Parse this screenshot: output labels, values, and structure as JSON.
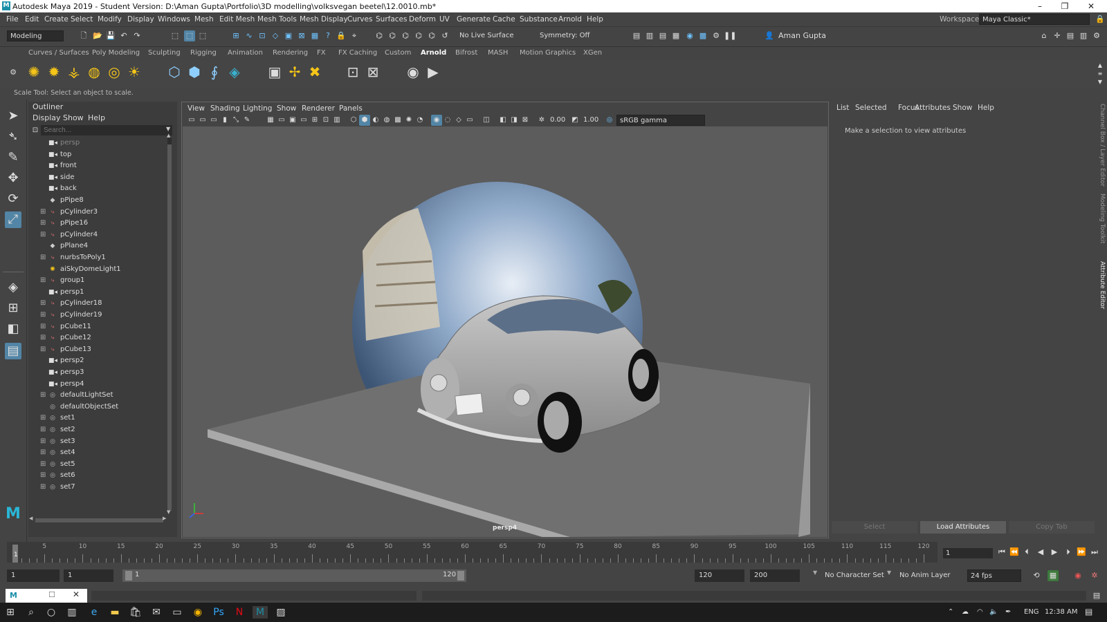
{
  "titlebar": {
    "logo": "M",
    "title": "Autodesk Maya 2019 - Student Version: D:\\Aman Gupta\\Portfolio\\3D modelling\\volksvegan beetel\\12.0010.mb*",
    "minimize": "–",
    "restore": "❐",
    "close": "✕"
  },
  "menubar": {
    "items": [
      "File",
      "Edit",
      "Create",
      "Select",
      "Modify",
      "Display",
      "Windows",
      "Mesh",
      "Edit Mesh",
      "Mesh Tools",
      "Mesh Display",
      "Curves",
      "Surfaces",
      "Deform",
      "UV",
      "Generate",
      "Cache",
      "Substance",
      "Arnold",
      "Help"
    ],
    "workspace_label": "Workspace :",
    "workspace_value": "Maya Classic*"
  },
  "statusline": {
    "mode": "Modeling",
    "live_surface": "No Live Surface",
    "symmetry": "Symmetry: Off",
    "user": "Aman Gupta"
  },
  "shelf": {
    "tabs": [
      "Curves / Surfaces",
      "Poly Modeling",
      "Sculpting",
      "Rigging",
      "Animation",
      "Rendering",
      "FX",
      "FX Caching",
      "Custom",
      "Arnold",
      "Bifrost",
      "MASH",
      "Motion Graphics",
      "XGen"
    ],
    "active_tab": "Arnold"
  },
  "helpline": {
    "text": "Scale Tool: Select an object to scale."
  },
  "outliner": {
    "title": "Outliner",
    "menu": [
      "Display",
      "Show",
      "Help"
    ],
    "search_placeholder": "Search...",
    "items": [
      {
        "label": "persp",
        "icon": "camera-icon",
        "expand": false,
        "dim": true
      },
      {
        "label": "top",
        "icon": "camera-icon",
        "expand": false
      },
      {
        "label": "front",
        "icon": "camera-icon",
        "expand": false
      },
      {
        "label": "side",
        "icon": "camera-icon",
        "expand": false
      },
      {
        "label": "back",
        "icon": "camera-icon",
        "expand": false
      },
      {
        "label": "pPipe8",
        "icon": "mesh-icon",
        "expand": false
      },
      {
        "label": "pCylinder3",
        "icon": "transform-icon",
        "expand": true
      },
      {
        "label": "pPipe16",
        "icon": "transform-icon",
        "expand": true
      },
      {
        "label": "pCylinder4",
        "icon": "transform-icon",
        "expand": true
      },
      {
        "label": "pPlane4",
        "icon": "mesh-icon",
        "expand": false
      },
      {
        "label": "nurbsToPoly1",
        "icon": "transform-icon",
        "expand": true
      },
      {
        "label": "aiSkyDomeLight1",
        "icon": "light-icon",
        "expand": false
      },
      {
        "label": "group1",
        "icon": "transform-icon",
        "expand": true
      },
      {
        "label": "persp1",
        "icon": "camera-icon",
        "expand": false
      },
      {
        "label": "pCylinder18",
        "icon": "transform-icon",
        "expand": true
      },
      {
        "label": "pCylinder19",
        "icon": "transform-icon",
        "expand": true
      },
      {
        "label": "pCube11",
        "icon": "transform-icon",
        "expand": true
      },
      {
        "label": "pCube12",
        "icon": "transform-icon",
        "expand": true
      },
      {
        "label": "pCube13",
        "icon": "transform-icon",
        "expand": true
      },
      {
        "label": "persp2",
        "icon": "camera-icon",
        "expand": false
      },
      {
        "label": "persp3",
        "icon": "camera-icon",
        "expand": false
      },
      {
        "label": "persp4",
        "icon": "camera-icon",
        "expand": false
      },
      {
        "label": "defaultLightSet",
        "icon": "set-icon",
        "expand": true
      },
      {
        "label": "defaultObjectSet",
        "icon": "set-icon",
        "expand": false
      },
      {
        "label": "set1",
        "icon": "set-icon",
        "expand": true
      },
      {
        "label": "set2",
        "icon": "set-icon",
        "expand": true
      },
      {
        "label": "set3",
        "icon": "set-icon",
        "expand": true
      },
      {
        "label": "set4",
        "icon": "set-icon",
        "expand": true
      },
      {
        "label": "set5",
        "icon": "set-icon",
        "expand": true
      },
      {
        "label": "set6",
        "icon": "set-icon",
        "expand": true
      },
      {
        "label": "set7",
        "icon": "set-icon",
        "expand": true
      }
    ]
  },
  "viewport": {
    "menu": [
      "View",
      "Shading",
      "Lighting",
      "Show",
      "Renderer",
      "Panels"
    ],
    "exposure": "0.00",
    "gamma": "1.00",
    "color_space": "sRGB gamma",
    "camera_label": "persp4"
  },
  "attribute_editor": {
    "menu": [
      "List",
      "Selected",
      "Focus",
      "Attributes",
      "Show",
      "Help"
    ],
    "message": "Make a selection to view attributes",
    "buttons": [
      "Select",
      "Load Attributes",
      "Copy Tab"
    ],
    "side_tabs": [
      "Channel Box / Layer Editor",
      "Modeling Toolkit",
      "Attribute Editor"
    ]
  },
  "timeslider": {
    "ticks": [
      "5",
      "10",
      "15",
      "20",
      "25",
      "30",
      "35",
      "40",
      "45",
      "50",
      "55",
      "60",
      "65",
      "70",
      "75",
      "80",
      "85",
      "90",
      "95",
      "100",
      "105",
      "110",
      "115",
      "120"
    ],
    "start_label": "1",
    "current_frame": "1"
  },
  "rangebar": {
    "start": "1",
    "anim_start": "1",
    "range_start": "1",
    "range_end": "120",
    "anim_end": "120",
    "end": "200",
    "character_set": "No Character Set",
    "anim_layer": "No Anim Layer",
    "fps": "24 fps"
  },
  "taskbar": {
    "lang": "ENG",
    "time": "12:38 AM"
  },
  "colors": {
    "accent": "#5285a6",
    "highlight_blue": "#6fc3ff",
    "arnold_yellow": "#f5c518"
  }
}
